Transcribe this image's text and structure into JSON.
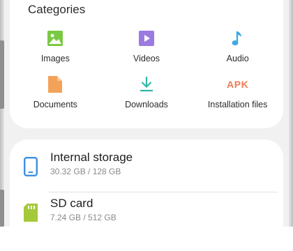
{
  "categories": {
    "title": "Categories",
    "items": [
      {
        "label": "Images",
        "icon": "image-icon",
        "color": "#7ac943"
      },
      {
        "label": "Videos",
        "icon": "video-icon",
        "color": "#9c7be0"
      },
      {
        "label": "Audio",
        "icon": "music-note-icon",
        "color": "#41a9e6"
      },
      {
        "label": "Documents",
        "icon": "document-icon",
        "color": "#f3a259"
      },
      {
        "label": "Downloads",
        "icon": "download-icon",
        "color": "#2fb8a6"
      },
      {
        "label": "Installation files",
        "icon": "apk-icon",
        "icon_text": "APK",
        "color": "#ef7a55"
      }
    ]
  },
  "storage": {
    "items": [
      {
        "name": "Internal storage",
        "size": "30.32 GB / 128 GB",
        "icon": "phone-icon",
        "color": "#3c8fe4"
      },
      {
        "name": "SD card",
        "size": "7.24 GB / 512 GB",
        "icon": "sd-card-icon",
        "color": "#a4c93a"
      }
    ]
  }
}
